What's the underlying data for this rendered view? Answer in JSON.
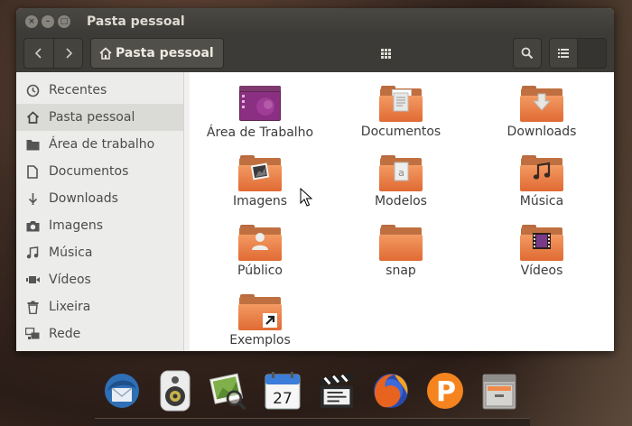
{
  "window": {
    "title": "Pasta pessoal",
    "controls": {
      "close": "×",
      "minimize": "–",
      "maximize": "□"
    }
  },
  "toolbar": {
    "back_icon": "chevron-left-icon",
    "forward_icon": "chevron-right-icon",
    "path_label": "Pasta pessoal",
    "search_icon": "search-icon",
    "list_view_icon": "list-icon",
    "grid_view_icon": "grid-icon",
    "grid_view_active": true
  },
  "sidebar": {
    "items": [
      {
        "label": "Recentes",
        "icon": "clock-icon"
      },
      {
        "label": "Pasta pessoal",
        "icon": "home-icon",
        "active": true
      },
      {
        "label": "Área de trabalho",
        "icon": "folder-icon"
      },
      {
        "label": "Documentos",
        "icon": "document-icon"
      },
      {
        "label": "Downloads",
        "icon": "download-icon"
      },
      {
        "label": "Imagens",
        "icon": "camera-icon"
      },
      {
        "label": "Música",
        "icon": "music-icon"
      },
      {
        "label": "Vídeos",
        "icon": "video-icon"
      },
      {
        "label": "Lixeira",
        "icon": "trash-icon"
      },
      {
        "label": "Rede",
        "icon": "network-icon"
      }
    ]
  },
  "files": [
    {
      "label": "Área de Trabalho",
      "icon": "desktop-folder-icon"
    },
    {
      "label": "Documentos",
      "icon": "documents-folder-icon"
    },
    {
      "label": "Downloads",
      "icon": "downloads-folder-icon"
    },
    {
      "label": "Imagens",
      "icon": "pictures-folder-icon"
    },
    {
      "label": "Modelos",
      "icon": "templates-folder-icon"
    },
    {
      "label": "Música",
      "icon": "music-folder-icon"
    },
    {
      "label": "Público",
      "icon": "public-folder-icon"
    },
    {
      "label": "snap",
      "icon": "folder-icon"
    },
    {
      "label": "Vídeos",
      "icon": "videos-folder-icon"
    },
    {
      "label": "Exemplos",
      "icon": "examples-folder-icon"
    }
  ],
  "dock": {
    "items": [
      {
        "icon": "thunderbird-icon"
      },
      {
        "icon": "speaker-icon"
      },
      {
        "icon": "image-viewer-icon"
      },
      {
        "icon": "calendar-icon",
        "label": "27"
      },
      {
        "icon": "video-editor-icon"
      },
      {
        "icon": "firefox-icon"
      },
      {
        "icon": "p-app-icon",
        "label": "P"
      },
      {
        "icon": "file-cabinet-icon"
      }
    ]
  },
  "colors": {
    "folder_orange": "#e8743b",
    "titlebar": "#3c3b37",
    "sidebar_active": "#dadad7",
    "accent_purple": "#77216f"
  }
}
